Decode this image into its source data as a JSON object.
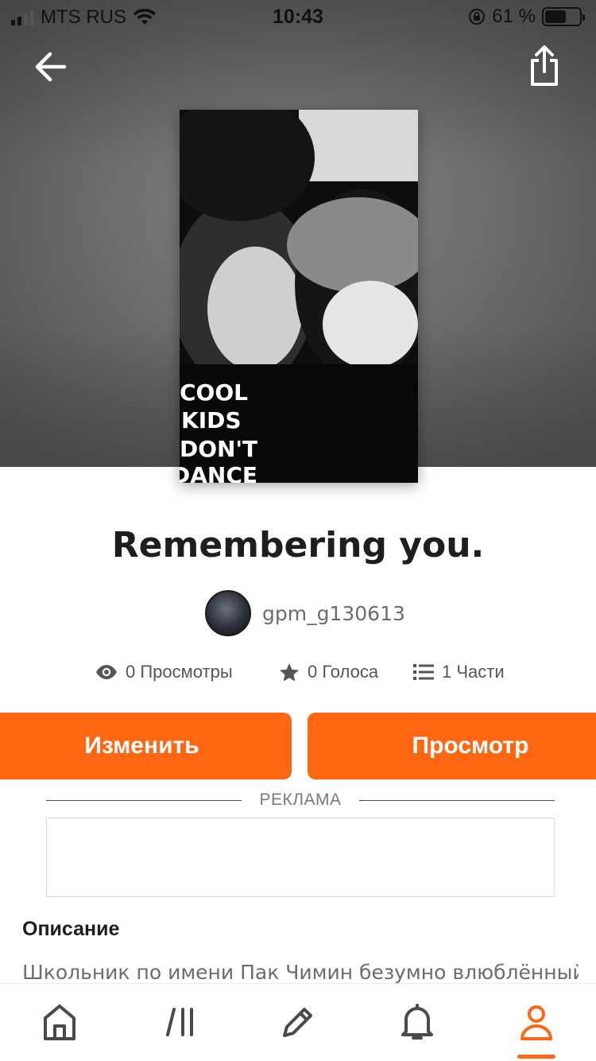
{
  "status_bar": {
    "carrier": "MTS RUS",
    "time": "10:43",
    "battery": "61 %",
    "battery_level": 0.61
  },
  "header": {
    "back_icon": "arrow-left-icon",
    "share_icon": "share-icon"
  },
  "story": {
    "title": "Remembering you.",
    "author": "gpm_g130613",
    "cover_text": [
      "COOL",
      "KIDS",
      "DON'T",
      "DANCE"
    ]
  },
  "stats": {
    "views": "0 Просмотры",
    "votes": "0 Голоса",
    "parts": "1 Части"
  },
  "actions": {
    "edit_label": "Изменить",
    "view_label": "Просмотр",
    "accent_color": "#ff6713"
  },
  "ad": {
    "label": "РЕКЛАМА"
  },
  "description": {
    "heading": "Описание",
    "text": "Школьник по имени Пак Чимин безумно влюблённый"
  },
  "tabbar": {
    "items": [
      {
        "icon": "home-icon"
      },
      {
        "icon": "browse-icon"
      },
      {
        "icon": "pencil-icon"
      },
      {
        "icon": "bell-icon"
      },
      {
        "icon": "profile-icon",
        "active": true
      }
    ]
  }
}
